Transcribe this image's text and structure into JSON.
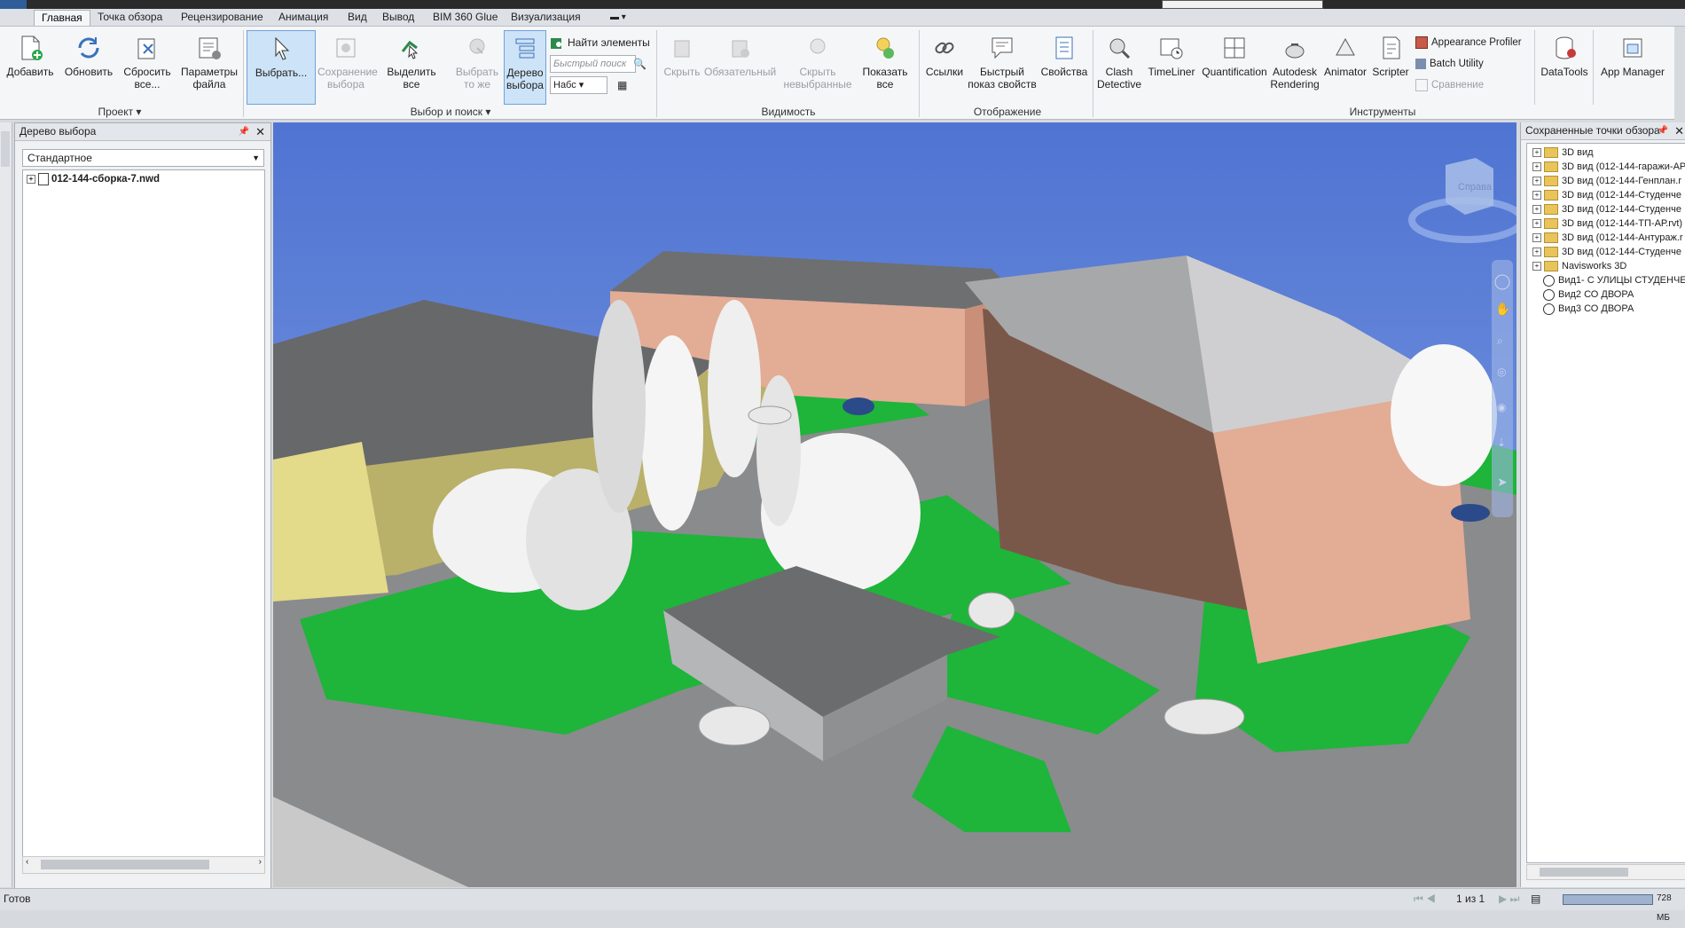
{
  "tabs": [
    "Главная",
    "Точка обзора",
    "Рецензирование",
    "Анимация",
    "Вид",
    "Вывод",
    "BIM 360 Glue",
    "Визуализация"
  ],
  "ribbon": {
    "project": {
      "title": "Проект",
      "add": "Добавить",
      "refresh": "Обновить",
      "reset": "Сбросить\nвсе...",
      "file_options": "Параметры\nфайла"
    },
    "select": {
      "title": "Выбор и поиск",
      "select": "Выбрать...",
      "save_selection": "Сохранение\nвыбора",
      "select_all": "Выделить\nвсе",
      "select_same": "Выбрать\nто же",
      "selection_tree": "Дерево\nвыбора",
      "find_items": "Найти элементы",
      "quick_find": "Быстрый поиск",
      "sets": "Набс"
    },
    "visibility": {
      "title": "Видимость",
      "hide": "Скрыть",
      "required": "Обязательный",
      "hide_unselected": "Скрыть\nневыбранные",
      "unhide_all": "Показать\nвсе"
    },
    "display": {
      "title": "Отображение",
      "links": "Ссылки",
      "quick_properties": "Быстрый\nпоказ свойств",
      "properties": "Свойства"
    },
    "tools": {
      "title": "Инструменты",
      "clash": "Clash\nDetective",
      "timeliner": "TimeLiner",
      "quantification": "Quantification",
      "autodesk_rendering": "Autodesk\nRendering",
      "animator": "Animator",
      "scripter": "Scripter",
      "appearance_profiler": "Appearance Profiler",
      "batch_utility": "Batch Utility",
      "compare": "Сравнение",
      "datatools": "DataTools",
      "app_manager": "App Manager"
    }
  },
  "left_panel": {
    "title": "Дерево выбора",
    "dropdown": "Стандартное",
    "root_item": "012-144-сборка-7.nwd"
  },
  "right_panel": {
    "title": "Сохраненные точки обзора",
    "items": [
      "3D вид",
      "3D вид (012-144-гаражи-АР",
      "3D вид (012-144-Генплан.r",
      "3D вид (012-144-Студенче",
      "3D вид (012-144-Студенче",
      "3D вид (012-144-ТП-АР.rvt)",
      "3D вид (012-144-Антураж.r",
      "3D вид (012-144-Студенче",
      "Navisworks 3D",
      "Вид1- С УЛИЦЫ СТУДЕНЧЕ",
      "Вид2 СО ДВОРА",
      "Вид3 СО ДВОРА"
    ]
  },
  "viewcube": {
    "label": "Справа"
  },
  "status": {
    "text": "Готов",
    "page": "1 из 1",
    "memory": "728 МБ"
  },
  "colors": {
    "sky": "#5a7fd6",
    "grass": "#1fb43a",
    "road": "#7d7e80",
    "brick": "#e3ac95",
    "wall_yellow": "#b9b06a",
    "roof": "#6e6f71",
    "selected": "#cde3f7"
  }
}
